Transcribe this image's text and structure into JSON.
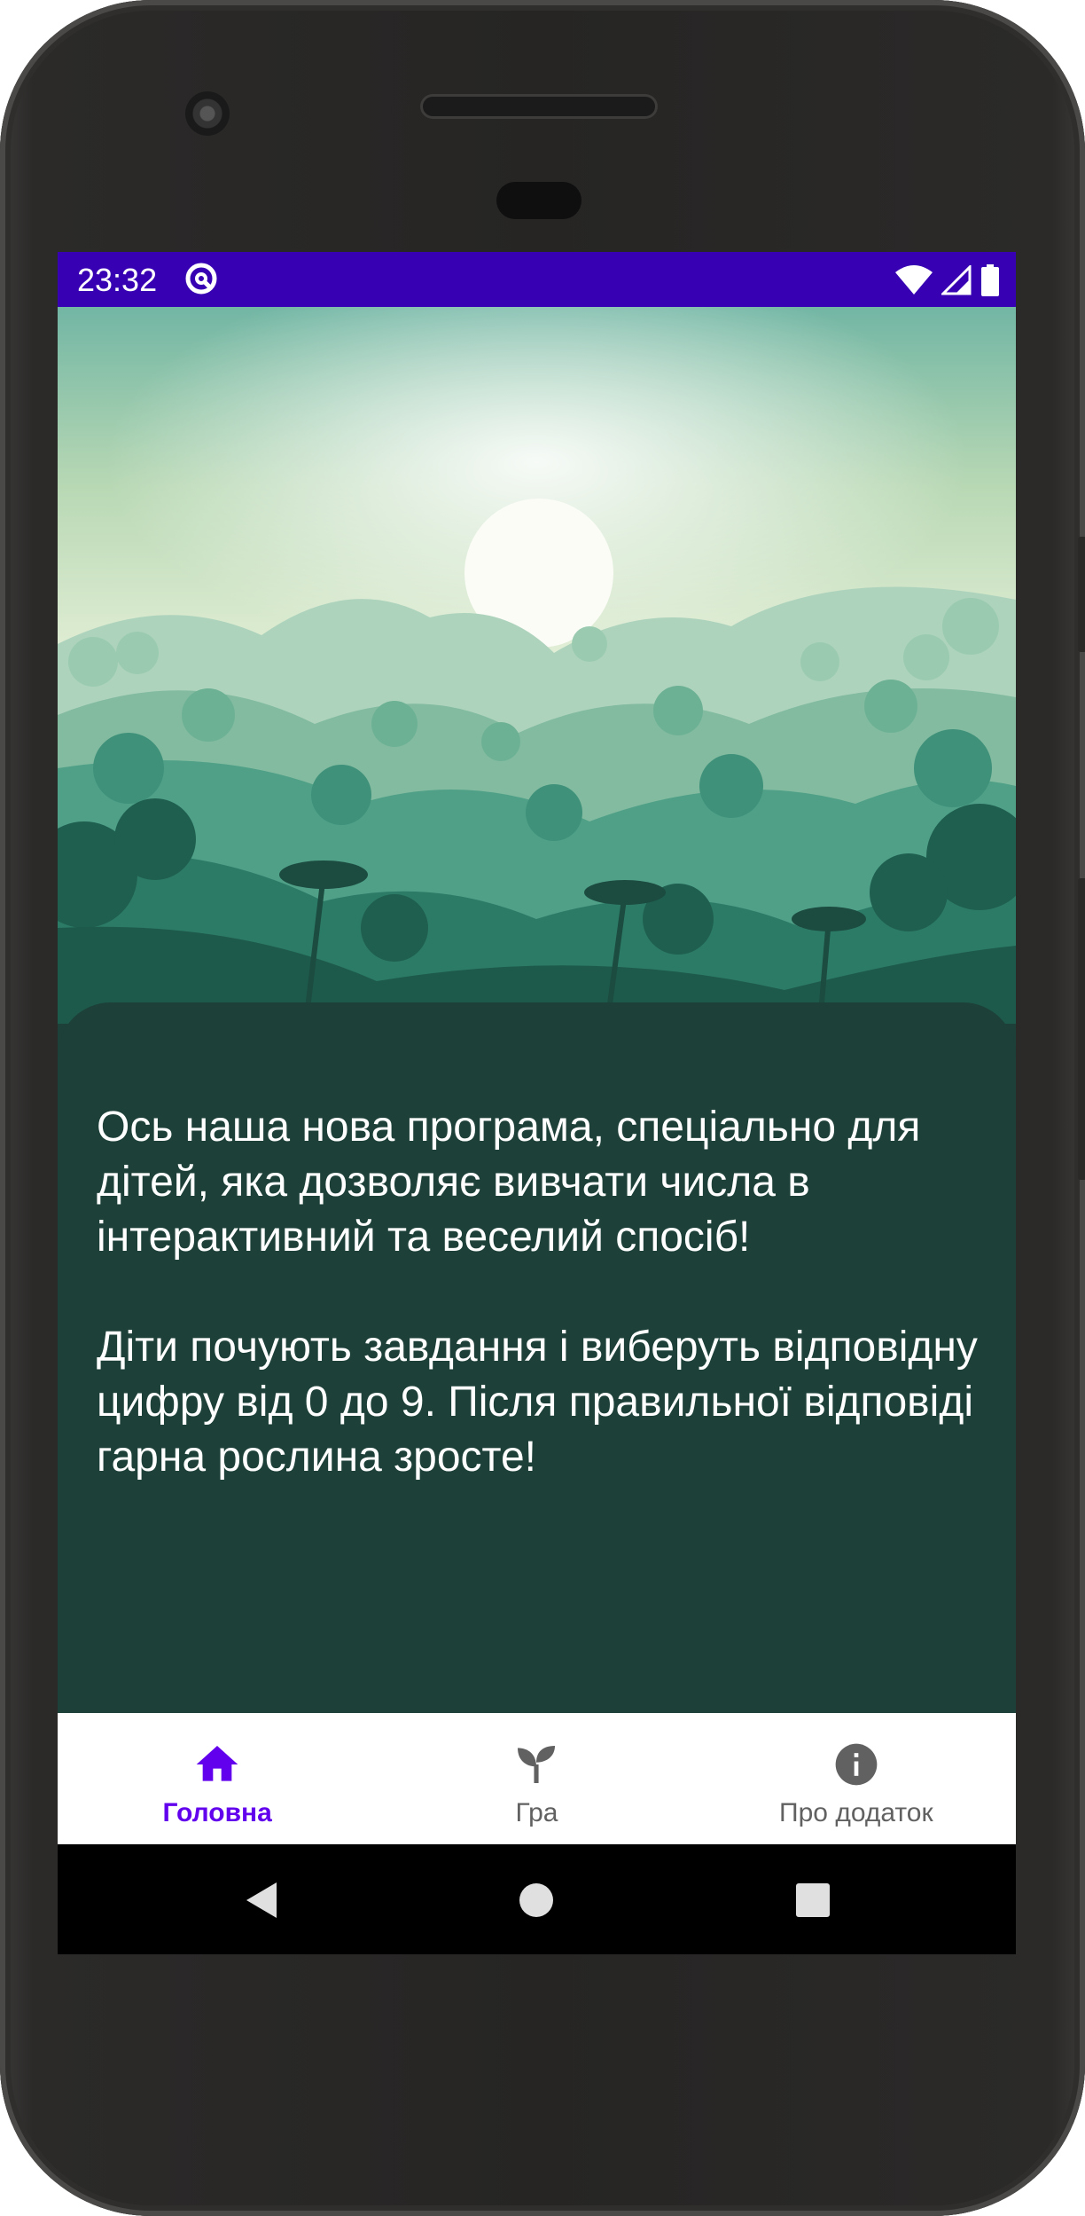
{
  "status_bar": {
    "time": "23:32",
    "app_icon": "at-sign-icon",
    "icons": [
      "wifi-icon",
      "signal-icon",
      "battery-icon"
    ],
    "color": "#3700b3"
  },
  "main": {
    "hero_image": "jungle-sunrise-landscape",
    "paragraph_1": "Ось наша нова програма, спеціально для дітей, яка дозволяє вивчати числа в інтерактивний та веселий спосіб!",
    "paragraph_2": "Діти почують завдання і виберуть відповідну цифру від 0 до 9. Після правильної відповіді гарна рослина зросте!",
    "background_color": "#1d4038"
  },
  "bottom_nav": {
    "items": [
      {
        "label": "Головна",
        "icon": "home-icon",
        "active": true
      },
      {
        "label": "Гра",
        "icon": "sprout-icon",
        "active": false
      },
      {
        "label": "Про додаток",
        "icon": "info-icon",
        "active": false
      }
    ],
    "active_color": "#6200ee",
    "inactive_color": "#616161"
  },
  "system_nav": {
    "buttons": [
      "back-icon",
      "home-circle-icon",
      "recents-icon"
    ]
  }
}
